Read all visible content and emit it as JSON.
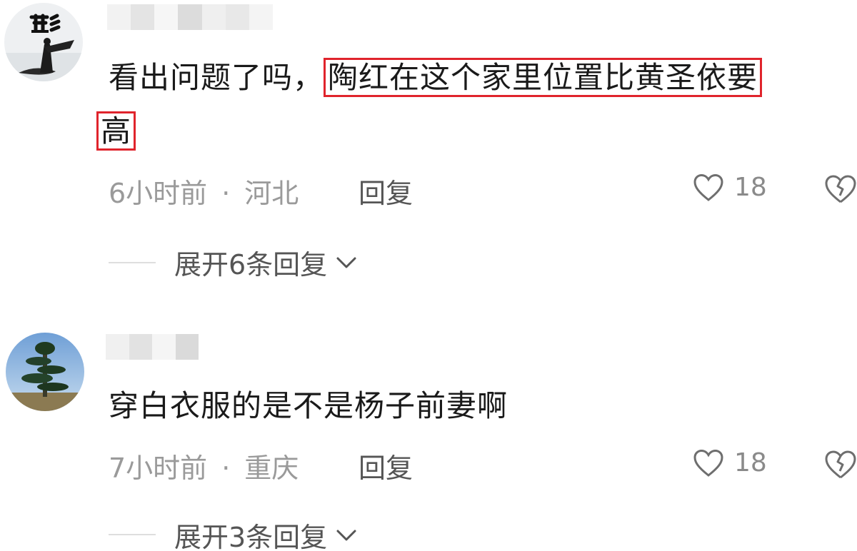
{
  "comments": [
    {
      "text_before": "看出问题了吗，",
      "text_highlight_line1": "陶红在这个家里位置比黄圣依要",
      "text_highlight_line2": "高",
      "time": "6小时前",
      "separator": "·",
      "location": "河北",
      "reply_label": "回复",
      "likes": "18",
      "expand_label": "展开6条回复"
    },
    {
      "text": "穿白衣服的是不是杨子前妻啊",
      "time": "7小时前",
      "separator": "·",
      "location": "重庆",
      "reply_label": "回复",
      "likes": "18",
      "expand_label": "展开3条回复"
    }
  ],
  "colors": {
    "highlight_border": "#e0242c",
    "meta_text": "#9a9a9a",
    "body_text": "#1a1a1a"
  },
  "icons": [
    "avatar",
    "heart-icon",
    "broken-heart-icon",
    "chevron-down-icon"
  ]
}
